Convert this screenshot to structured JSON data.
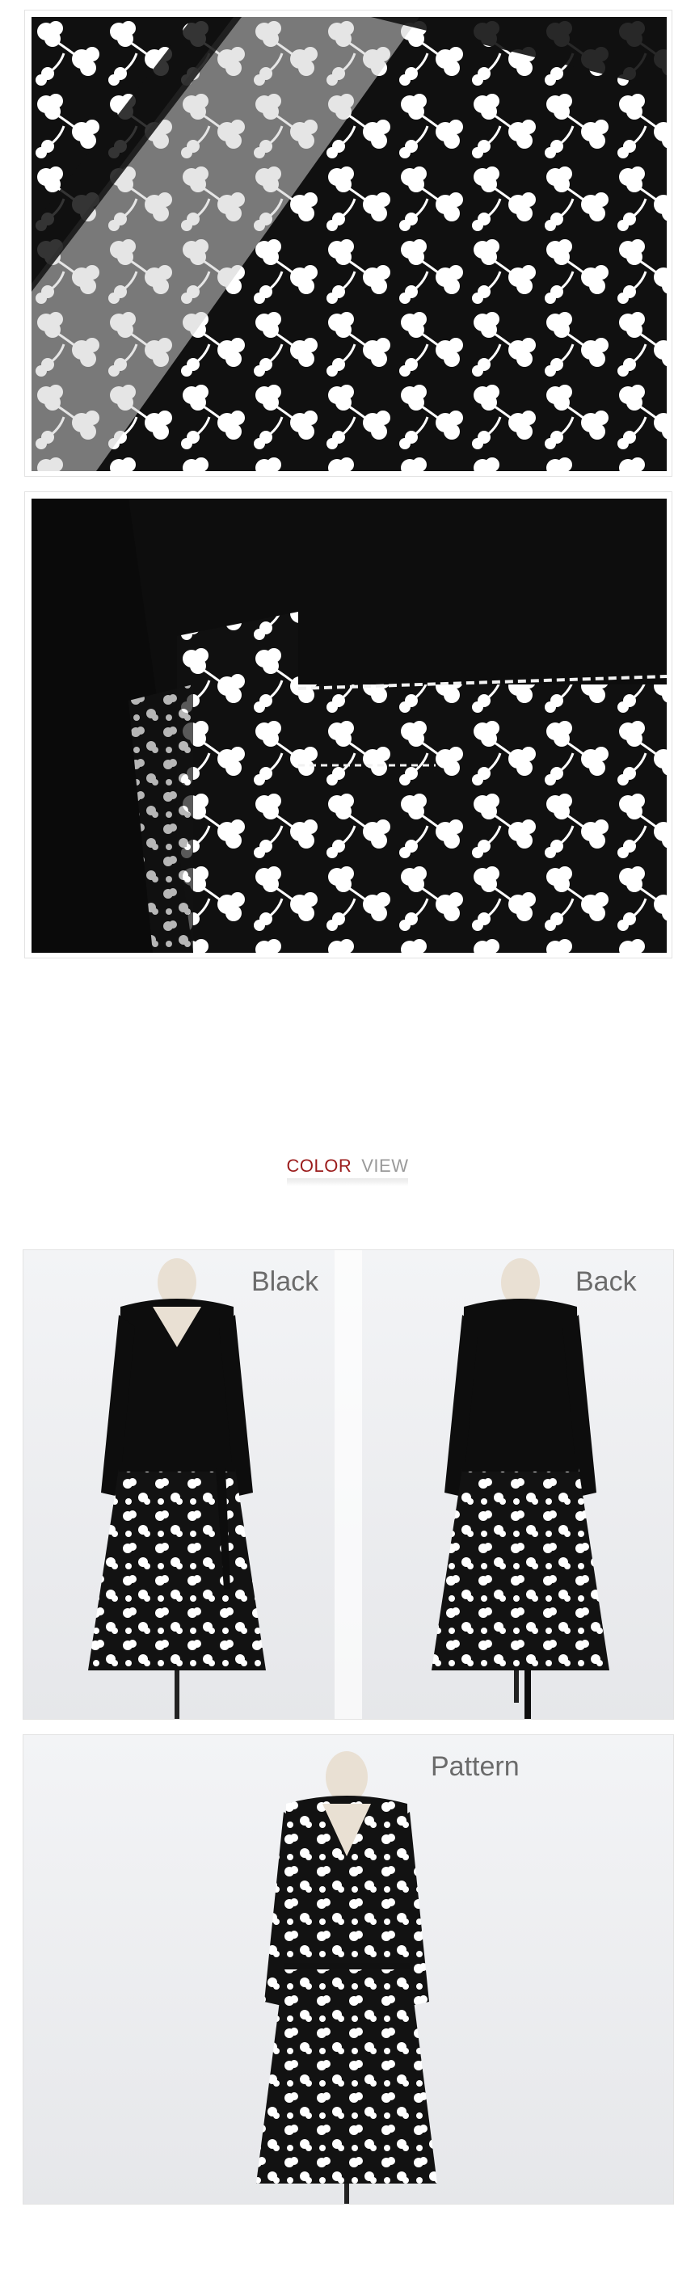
{
  "section_header": {
    "color_word": "COLOR",
    "view_word": "VIEW"
  },
  "variants": [
    {
      "label": "Black"
    },
    {
      "label": "Back"
    },
    {
      "label": "Pattern"
    }
  ],
  "colors": {
    "accent_red": "#9b1c1c",
    "label_gray": "#6b6b6b",
    "fabric_black": "#0f0f0f",
    "print_white": "#ffffff"
  }
}
